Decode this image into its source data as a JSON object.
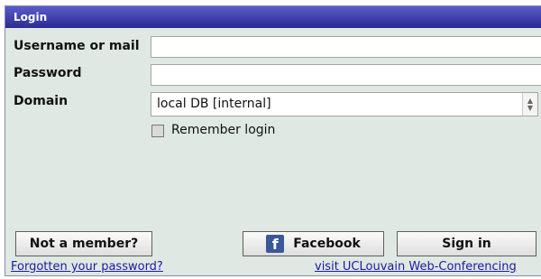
{
  "header": {
    "title": "Login"
  },
  "form": {
    "username_label": "Username or mail",
    "username_value": "",
    "password_label": "Password",
    "password_value": "",
    "domain_label": "Domain",
    "domain_selected": "local DB [internal]",
    "remember_label": "Remember login",
    "remember_checked": false
  },
  "buttons": {
    "not_member": "Not a member?",
    "facebook": "Facebook",
    "facebook_icon": "f",
    "sign_in": "Sign in"
  },
  "links": {
    "forgot": "Forgotten your password?",
    "visit": "visit UCLouvain Web-Conferencing"
  },
  "colors": {
    "titlebar": "#3a3aa8",
    "panel_bg": "#dfe8e2",
    "facebook_blue": "#3b5998",
    "link": "#1a1aa6"
  },
  "icons": [
    "facebook-icon",
    "spinner-arrows-icon",
    "checkbox"
  ]
}
